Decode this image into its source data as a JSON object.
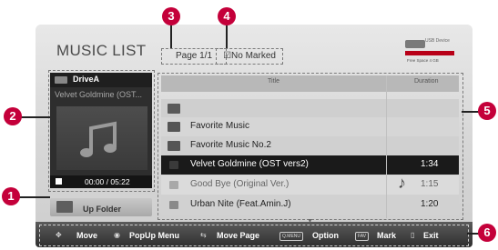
{
  "window": {
    "title": "MUSIC LIST"
  },
  "header": {
    "page_label": "Page 1/1",
    "marked_label": "No Marked",
    "usb": {
      "device_label": "USB Device",
      "free_space": "Free Space 4 GB"
    }
  },
  "preview": {
    "drive": "DriveA",
    "song": "Velvet Goldmine (OST...",
    "time": "00:00 / 05:22"
  },
  "up_folder": {
    "label": "Up Folder"
  },
  "table": {
    "columns": [
      "Title",
      "Duration"
    ],
    "rows": [
      {
        "type": "up",
        "title": "",
        "duration": ""
      },
      {
        "type": "folder",
        "title": "Favorite Music",
        "duration": ""
      },
      {
        "type": "folder",
        "title": "Favorite Music No.2",
        "duration": ""
      },
      {
        "type": "file",
        "title": "Velvet Goldmine (OST vers2)",
        "duration": "1:34",
        "selected": true
      },
      {
        "type": "file",
        "title": "Good Bye (Original Ver.)",
        "duration": "1:15",
        "playing": true
      },
      {
        "type": "file",
        "title": "Urban Nite (Feat.Amin.J)",
        "duration": "1:20"
      }
    ]
  },
  "bottom_bar": {
    "move": "Move",
    "popup": "PopUp Menu",
    "move_page": "Move Page",
    "qmenu_key": "Q.MENU",
    "option": "Option",
    "fav_key": "FAV",
    "mark": "Mark",
    "exit": "Exit"
  },
  "callouts": [
    "1",
    "2",
    "3",
    "4",
    "5",
    "6"
  ],
  "colors": {
    "callout": "#c4003a",
    "usb_bar": "#b80018",
    "selected_row": "#1a1a1a"
  }
}
